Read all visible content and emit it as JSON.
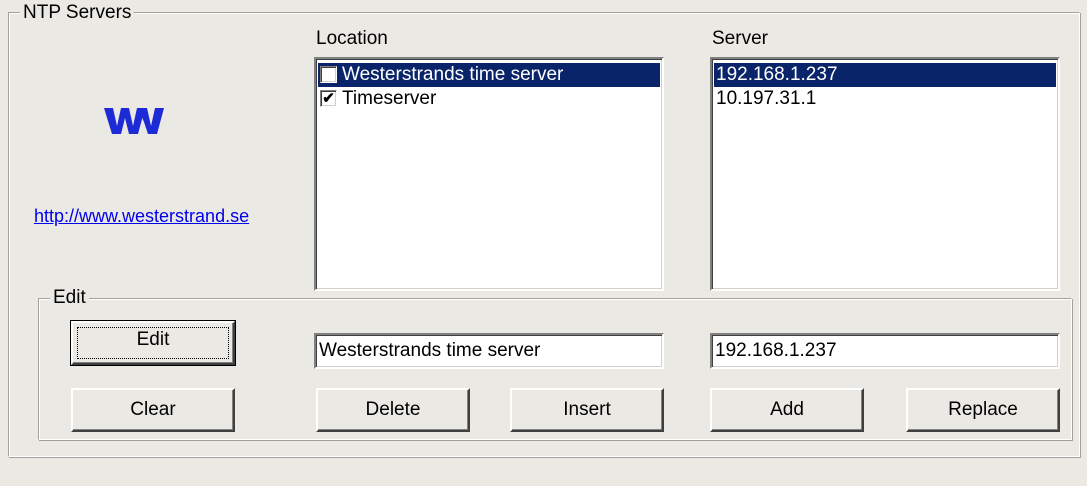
{
  "ntp_group": {
    "title": "NTP Servers"
  },
  "logo": {
    "text": "W"
  },
  "website": {
    "url_text": "http://www.westerstrand.se"
  },
  "location": {
    "label": "Location",
    "items": [
      {
        "name": "Westerstrands time server",
        "checked": false,
        "selected": true
      },
      {
        "name": "Timeserver",
        "checked": true,
        "selected": false
      }
    ]
  },
  "server": {
    "label": "Server",
    "items": [
      {
        "address": "192.168.1.237",
        "selected": true
      },
      {
        "address": "10.197.31.1",
        "selected": false
      }
    ]
  },
  "edit_group": {
    "title": "Edit",
    "location_value": "Westerstrands time server",
    "server_value": "192.168.1.237",
    "buttons": {
      "edit": "Edit",
      "clear": "Clear",
      "delete": "Delete",
      "insert": "Insert",
      "add": "Add",
      "replace": "Replace"
    }
  },
  "colors": {
    "selection": "#0a246a",
    "logo": "#1c2bd6",
    "link": "#0000ee"
  },
  "icons": {
    "check_mark": "✔"
  }
}
